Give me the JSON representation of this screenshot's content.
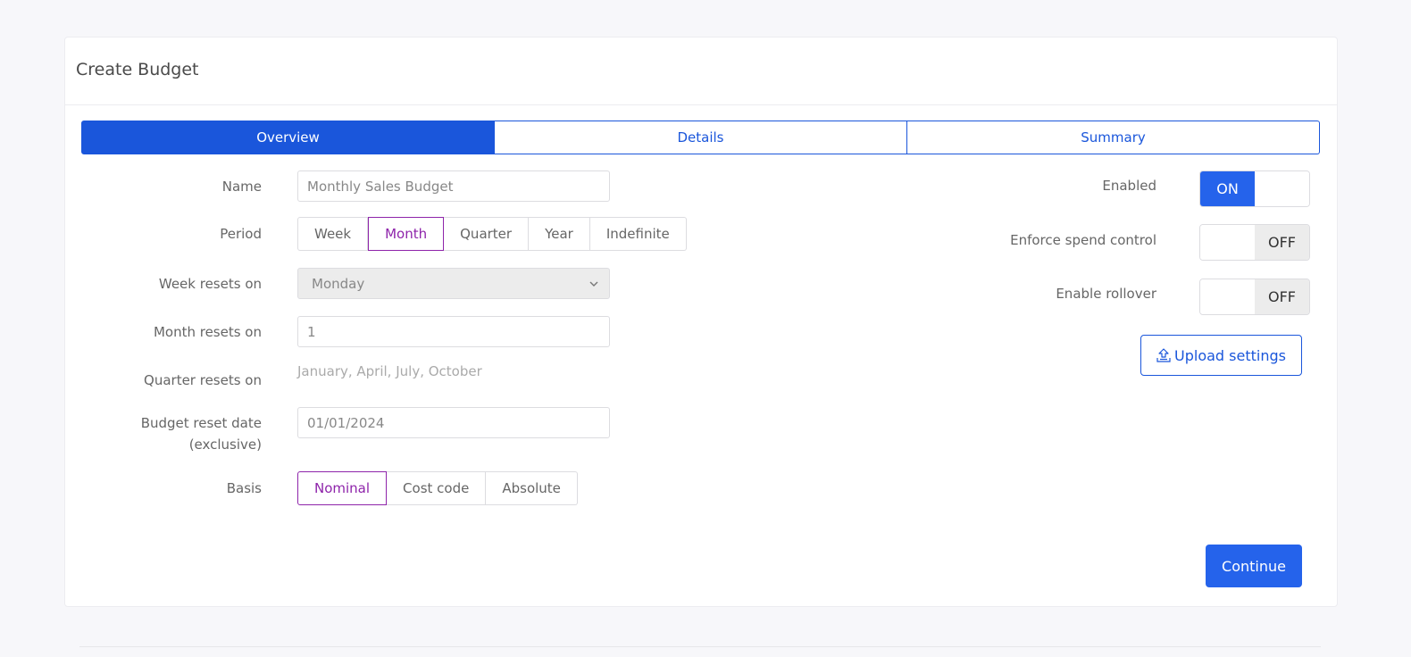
{
  "card": {
    "title": "Create Budget"
  },
  "tabs": [
    {
      "label": "Overview",
      "active": true
    },
    {
      "label": "Details",
      "active": false
    },
    {
      "label": "Summary",
      "active": false
    }
  ],
  "form": {
    "name": {
      "label": "Name",
      "value": "Monthly Sales Budget"
    },
    "period": {
      "label": "Period",
      "options": [
        "Week",
        "Month",
        "Quarter",
        "Year",
        "Indefinite"
      ],
      "selected": "Month"
    },
    "week_resets_on": {
      "label": "Week resets on",
      "value": "Monday",
      "icon": "chevron-down-icon"
    },
    "month_resets_on": {
      "label": "Month resets on",
      "value": "1"
    },
    "quarter_resets_on": {
      "label": "Quarter resets on",
      "value": "January, April, July, October"
    },
    "budget_reset_date": {
      "label_line1": "Budget reset date",
      "label_line2": "(exclusive)",
      "value": "01/01/2024"
    },
    "basis": {
      "label": "Basis",
      "options": [
        "Nominal",
        "Cost code",
        "Absolute"
      ],
      "selected": "Nominal"
    }
  },
  "settings": {
    "enabled": {
      "label": "Enabled",
      "state": "ON"
    },
    "enforce_spend_control": {
      "label": "Enforce spend control",
      "state": "OFF"
    },
    "enable_rollover": {
      "label": "Enable rollover",
      "state": "OFF"
    }
  },
  "buttons": {
    "upload_settings": "Upload settings",
    "upload_icon": "upload-icon",
    "continue": "Continue"
  },
  "colors": {
    "primary": "#1a56db",
    "button_primary": "#2563eb",
    "selected_segment": "#8e24aa"
  }
}
